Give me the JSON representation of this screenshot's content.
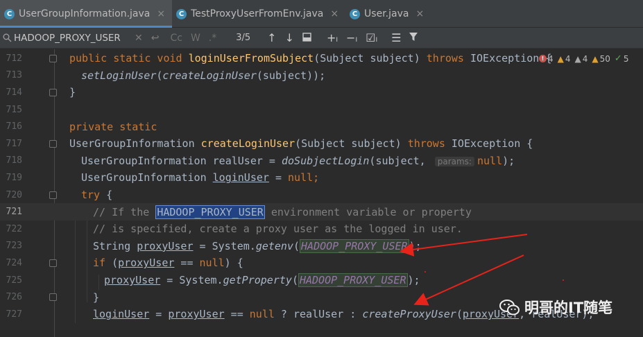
{
  "tabs": [
    {
      "label": "UserGroupInformation.java",
      "icon": "class-icon",
      "active": true
    },
    {
      "label": "TestProxyUserFromEnv.java",
      "icon": "class-icon",
      "active": false
    },
    {
      "label": "User.java",
      "icon": "class-icon",
      "active": false
    }
  ],
  "search": {
    "value": "HADOOP_PROXY_USER",
    "match_count": "3/5",
    "case_label": "Cc",
    "words_label": "W",
    "regex_label": ".*"
  },
  "inspections": {
    "errors": "4",
    "warnings": "4",
    "weak_warnings": "4",
    "typos": "50",
    "ok": "5"
  },
  "line_numbers": [
    "712",
    "713",
    "714",
    "715",
    "716",
    "717",
    "718",
    "719",
    "720",
    "721",
    "722",
    "723",
    "724",
    "725",
    "726",
    "727"
  ],
  "code": {
    "l712": {
      "kw1": "public static void ",
      "fn": "loginUserFromSubject",
      "rest": "(Subject subject) ",
      "kw2": "throws",
      "tail": " IOException {"
    },
    "l713": {
      "fn": "setLoginUser",
      "p1": "(",
      "fn2": "createLoginUser",
      "p2": "(subject));"
    },
    "l714": {
      "text": "}"
    },
    "l716": {
      "kw": "private static"
    },
    "l717": {
      "type": "UserGroupInformation ",
      "fn": "createLoginUser",
      "rest": "(Subject subject) ",
      "kw": "throws",
      "tail": " IOException {"
    },
    "l718": {
      "pre": "UserGroupInformation realUser = ",
      "fn": "doSubjectLogin",
      "mid": "(subject, ",
      "hint": "params:",
      "kw": "null",
      "tail": ");"
    },
    "l719": {
      "pre": "UserGroupInformation ",
      "var": "loginUser",
      "mid": " = ",
      "kw": "null",
      "tail": ";"
    },
    "l720": {
      "kw": "try",
      "tail": " {"
    },
    "l721": {
      "pre": "// If the ",
      "sel": "HADOOP_PROXY_USER",
      "tail": " environment variable or property"
    },
    "l722": {
      "text": "// is specified, create a proxy user as the logged in user."
    },
    "l723": {
      "pre": "String ",
      "var": "proxyUser",
      "mid": " = System.",
      "fn": "getenv",
      "p1": "(",
      "const": "HADOOP_PROXY_USER",
      "tail": ");"
    },
    "l724": {
      "kw": "if",
      "p1": " (",
      "var": "proxyUser",
      "mid": " == ",
      "kw2": "null",
      "tail": ") {"
    },
    "l725": {
      "var": "proxyUser",
      "mid": " = System.",
      "fn": "getProperty",
      "p1": "(",
      "const": "HADOOP_PROXY_USER",
      "tail": ");"
    },
    "l726": {
      "text": "}"
    },
    "l727": {
      "var": "loginUser",
      "mid": " = ",
      "var2": "proxyUser",
      "mid2": " == ",
      "kw": "null",
      "mid3": " ? realUser : ",
      "fn": "createProxyUser",
      "p1": "(",
      "var3": "proxyUser",
      "tail": ", realUser);"
    }
  },
  "watermark": {
    "text": "明哥的IT随笔"
  },
  "colors": {
    "keyword": "#cc7832",
    "function": "#ffc66d",
    "text": "#a9b7c6",
    "comment": "#808080",
    "constant": "#9876aa",
    "arrow": "#e8231a",
    "selection": "#214283"
  }
}
